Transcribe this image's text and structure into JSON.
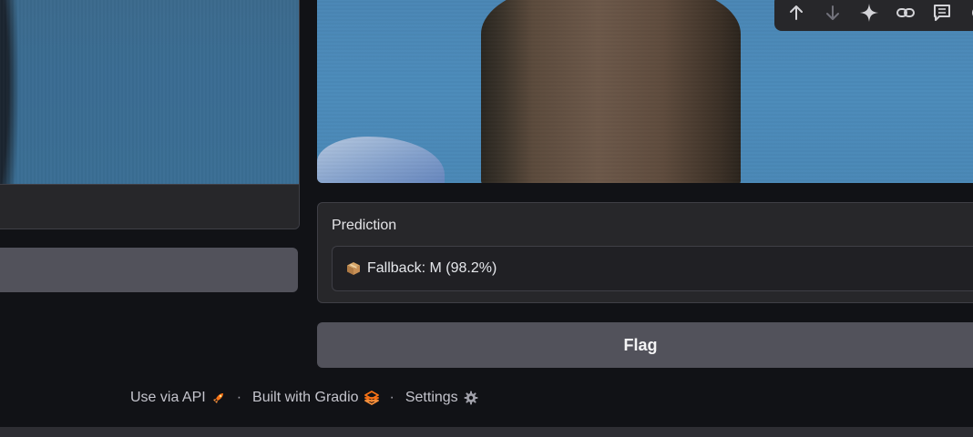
{
  "prediction": {
    "label": "Prediction",
    "value": "Fallback: M (98.2%)",
    "icon": "package-icon"
  },
  "flag_button": {
    "label": "Flag"
  },
  "toolbar": {
    "icons": [
      "arrow-up-icon",
      "arrow-down-icon",
      "sparkle-icon",
      "link-icon",
      "comment-icon",
      "gear-icon"
    ]
  },
  "footer": {
    "api_label": "Use via API",
    "built_label": "Built with Gradio",
    "settings_label": "Settings",
    "separator": "·"
  },
  "colors": {
    "background": "#111216",
    "panel": "#27272a",
    "button": "#52525b",
    "gradio_orange": "#f97316"
  }
}
